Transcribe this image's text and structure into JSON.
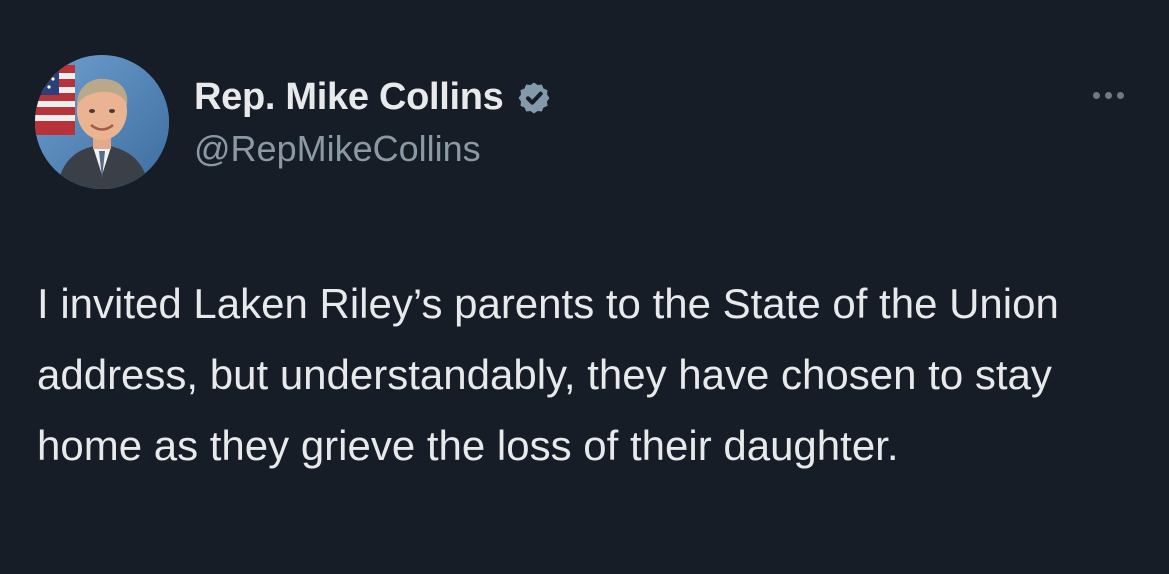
{
  "author": {
    "display_name": "Rep. Mike Collins",
    "handle": "@RepMikeCollins",
    "verified": true,
    "verified_badge_color": "#829aab"
  },
  "tweet": {
    "text": "I invited Laken Riley’s parents to the State of the Union address, but understandably, they have chosen to stay home as they grieve the loss of their daughter."
  },
  "icons": {
    "verified": "verified-badge-icon",
    "more": "more-options-icon"
  },
  "colors": {
    "background": "#161d27",
    "primary_text": "#e7e9ea",
    "secondary_text": "#8b98a5"
  }
}
